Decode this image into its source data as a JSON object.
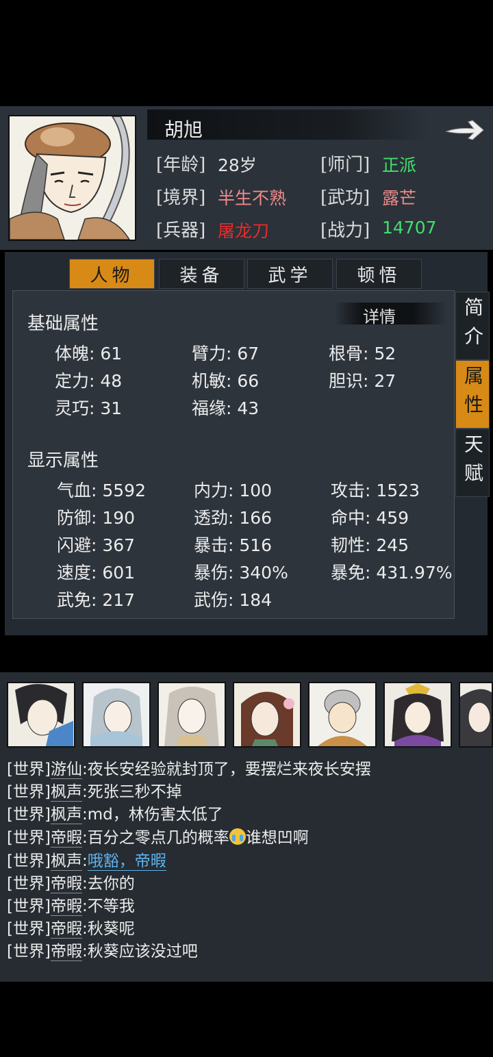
{
  "character": {
    "name": "胡旭",
    "info": [
      {
        "label": "[年龄]",
        "value": "28岁",
        "color": "#e4e4e4"
      },
      {
        "label": "[师门]",
        "value": "正派",
        "color": "#42e06a"
      },
      {
        "label": "[境界]",
        "value": "半生不熟",
        "color": "#f08a8a"
      },
      {
        "label": "[武功]",
        "value": "露芒",
        "color": "#f08a8a"
      },
      {
        "label": "[兵器]",
        "value": "屠龙刀",
        "color": "#e82a2a"
      },
      {
        "label": "[战力]",
        "value": "14707",
        "color": "#42e06a"
      }
    ]
  },
  "tabs": [
    "人物",
    "装备",
    "武学",
    "顿悟"
  ],
  "side_tabs": [
    "简介",
    "属性",
    "天赋"
  ],
  "panel": {
    "basic_title": "基础属性",
    "detail_label": "详情",
    "basic": [
      "体魄: 61",
      "臂力: 67",
      "根骨: 52",
      "定力: 48",
      "机敏: 66",
      "胆识: 27",
      "灵巧: 31",
      "福缘: 43"
    ],
    "display_title": "显示属性",
    "display": [
      "气血: 5592",
      "内力: 100",
      "攻击: 1523",
      "防御: 190",
      "透劲: 166",
      "命中: 459",
      "闪避: 367",
      "暴击: 516",
      "韧性: 245",
      "速度: 601",
      "暴伤: 340%",
      "暴免: 431.97%",
      "武免: 217",
      "武伤: 184"
    ]
  },
  "chat": [
    {
      "channel": "[世界]",
      "user": "游仙",
      "text": ":夜长安经验就封顶了，要摆烂来夜长安摆"
    },
    {
      "channel": "[世界]",
      "user": "枫声",
      "text": ":死张三秒不掉"
    },
    {
      "channel": "[世界]",
      "user": "枫声",
      "text": ":md，林伤害太低了"
    },
    {
      "channel": "[世界]",
      "user": "帝暇",
      "text": ":百分之零点几的概率",
      "text2": "谁想凹啊"
    },
    {
      "channel": "[世界]",
      "user": "枫声",
      "text": ":",
      "link": "哦豁，帝暇"
    },
    {
      "channel": "[世界]",
      "user": "帝暇",
      "text": ":去你的"
    },
    {
      "channel": "[世界]",
      "user": "帝暇",
      "text": ":不等我"
    },
    {
      "channel": "[世界]",
      "user": "帝暇",
      "text": ":秋葵呢"
    },
    {
      "channel": "[世界]",
      "user": "帝暇",
      "text": ":秋葵应该没过吧"
    }
  ]
}
